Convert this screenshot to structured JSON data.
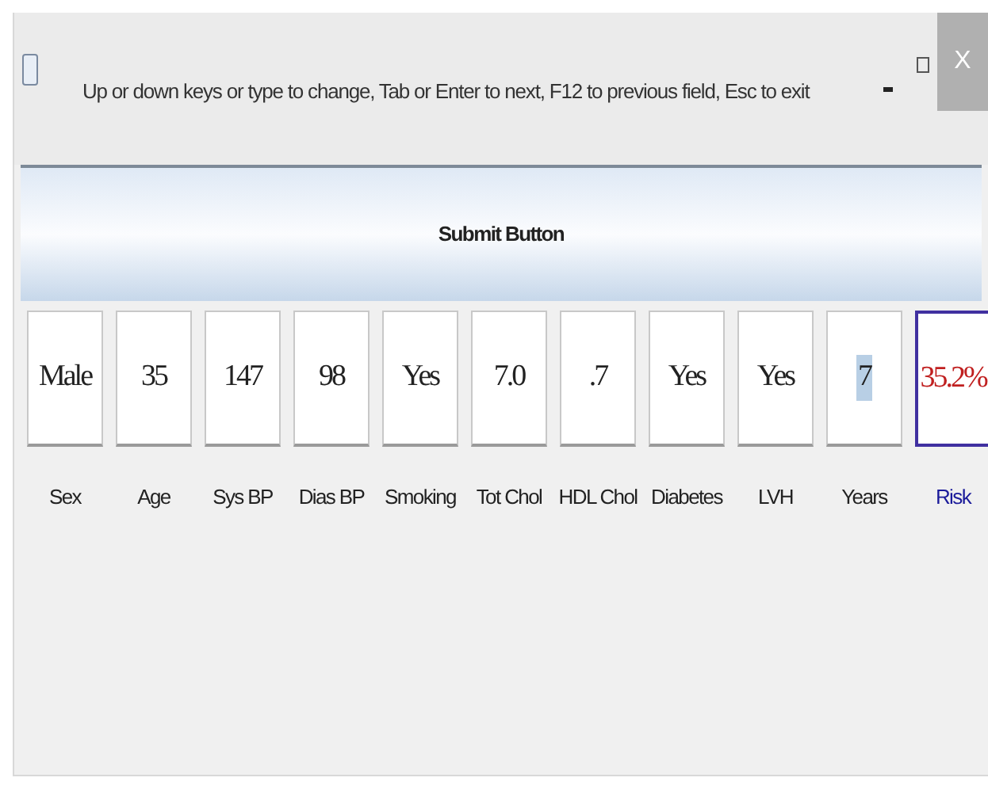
{
  "window": {
    "title": "Up or down keys or type to change, Tab or Enter to next, F12 to previous field, Esc to exit"
  },
  "close_button": {
    "label": "X"
  },
  "submit_button": {
    "label": "Submit Button"
  },
  "fields": [
    {
      "kind": "input",
      "value": "Male",
      "label": "Sex",
      "focused": false
    },
    {
      "kind": "input",
      "value": "35",
      "label": "Age",
      "focused": false
    },
    {
      "kind": "input",
      "value": "147",
      "label": "Sys BP",
      "focused": false
    },
    {
      "kind": "input",
      "value": "98",
      "label": "Dias BP",
      "focused": false
    },
    {
      "kind": "input",
      "value": "Yes",
      "label": "Smoking",
      "focused": false
    },
    {
      "kind": "input",
      "value": "7.0",
      "label": "Tot Chol",
      "focused": false
    },
    {
      "kind": "input",
      "value": ".7",
      "label": "HDL Chol",
      "focused": false
    },
    {
      "kind": "input",
      "value": "Yes",
      "label": "Diabetes",
      "focused": false
    },
    {
      "kind": "input",
      "value": "Yes",
      "label": "LVH",
      "focused": false
    },
    {
      "kind": "input",
      "value": "7",
      "label": "Years",
      "focused": true
    },
    {
      "kind": "result",
      "value": "35.2%",
      "label": "Risk",
      "focused": false
    }
  ]
}
